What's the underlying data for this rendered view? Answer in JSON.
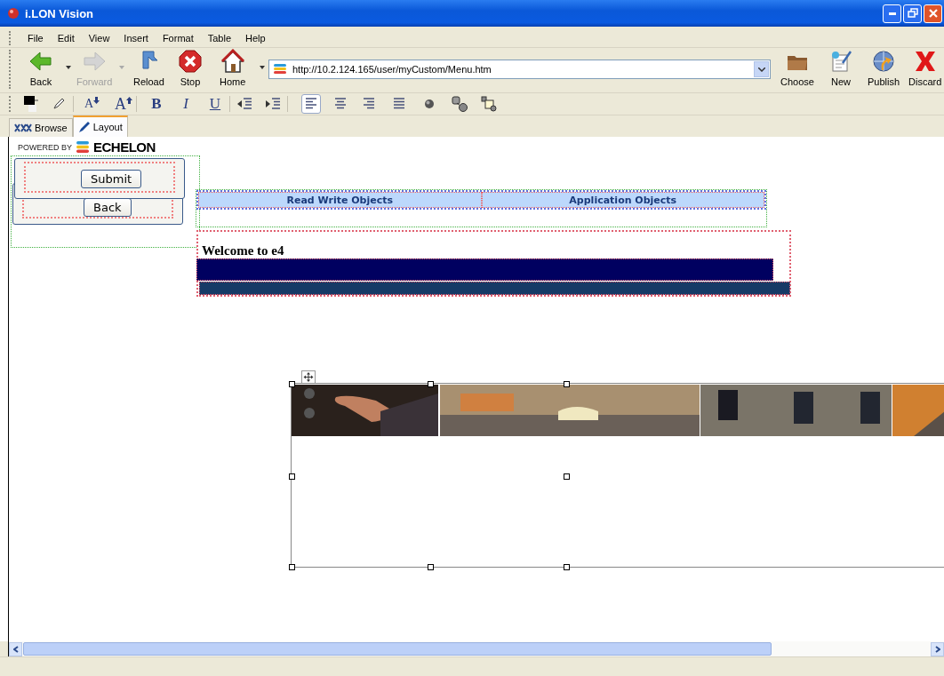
{
  "window": {
    "title": "i.LON Vision"
  },
  "menu": [
    "File",
    "Edit",
    "View",
    "Insert",
    "Format",
    "Table",
    "Help"
  ],
  "nav_toolbar": [
    {
      "kind": "back",
      "label": "Back",
      "disabled": false,
      "dropdown": true
    },
    {
      "kind": "forward",
      "label": "Forward",
      "disabled": true,
      "dropdown": true
    },
    {
      "kind": "reload",
      "label": "Reload",
      "disabled": false,
      "dropdown": false
    },
    {
      "kind": "stop",
      "label": "Stop",
      "disabled": false,
      "dropdown": false
    },
    {
      "kind": "home",
      "label": "Home",
      "disabled": false,
      "dropdown": true
    }
  ],
  "address": {
    "value": "http://10.2.124.165/user/myCustom/Menu.htm"
  },
  "file_toolbar": [
    {
      "kind": "choose",
      "label": "Choose"
    },
    {
      "kind": "new",
      "label": "New"
    },
    {
      "kind": "publish",
      "label": "Publish"
    },
    {
      "kind": "discard",
      "label": "Discard"
    }
  ],
  "format_toolbar": [
    {
      "kind": "color",
      "selected": false,
      "group_end": false
    },
    {
      "kind": "pencil",
      "selected": false,
      "group_end": true
    },
    {
      "kind": "font-smaller",
      "label": "A",
      "selected": false,
      "group_end": false
    },
    {
      "kind": "font-larger",
      "label": "A",
      "selected": false,
      "group_end": true
    },
    {
      "kind": "bold",
      "label": "B",
      "selected": false,
      "group_end": false
    },
    {
      "kind": "italic",
      "label": "I",
      "selected": false,
      "group_end": false
    },
    {
      "kind": "underline",
      "label": "U",
      "selected": false,
      "group_end": true
    },
    {
      "kind": "outdent",
      "selected": false,
      "group_end": false
    },
    {
      "kind": "indent",
      "selected": false,
      "group_end": true
    },
    {
      "kind": "align-left",
      "selected": true,
      "group_end": false
    },
    {
      "kind": "align-center",
      "selected": false,
      "group_end": false
    },
    {
      "kind": "align-right",
      "selected": false,
      "group_end": false
    },
    {
      "kind": "justify",
      "selected": false,
      "group_end": false
    },
    {
      "kind": "globe",
      "selected": false,
      "group_end": false
    },
    {
      "kind": "shapes",
      "selected": false,
      "group_end": false
    },
    {
      "kind": "layers",
      "selected": false,
      "group_end": false
    }
  ],
  "tabs": [
    {
      "kind": "browse",
      "label": "Browse",
      "selected": false
    },
    {
      "kind": "layout",
      "label": "Layout",
      "selected": true
    }
  ],
  "canvas": {
    "logo": {
      "prefix": "POWERED BY",
      "brand": "ECHELON"
    },
    "buttons": [
      {
        "label": "Submit"
      },
      {
        "label": "Back"
      }
    ],
    "nav_table": {
      "cells": [
        "Read Write Objects",
        "Application Objects"
      ]
    },
    "heading": "Welcome to e4",
    "image": {
      "kind": "picture",
      "selected": true
    }
  }
}
